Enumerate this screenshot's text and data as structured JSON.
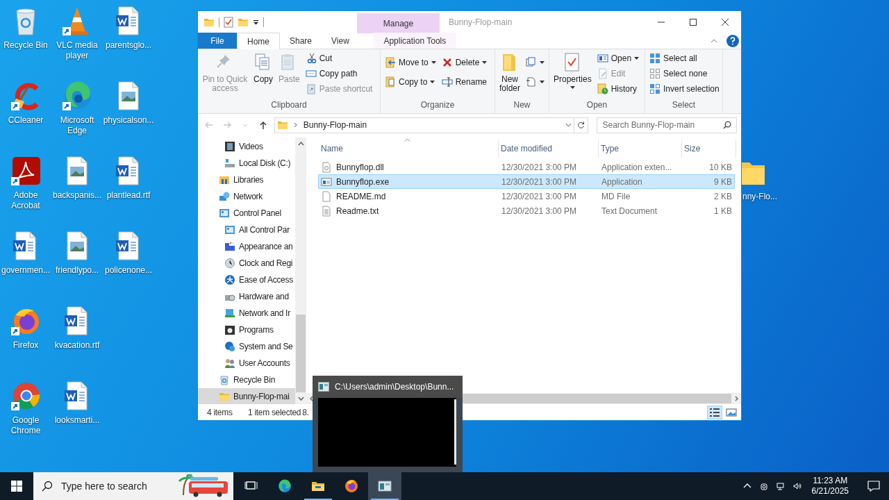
{
  "desktop_rows": [
    [
      {
        "label": "Recycle Bin",
        "kind": "recycle",
        "shortcut": false
      },
      {
        "label": "VLC media player",
        "kind": "vlc",
        "shortcut": true
      },
      {
        "label": "parentsglo...",
        "kind": "word",
        "shortcut": false
      }
    ],
    [
      {
        "label": "CCleaner",
        "kind": "ccleaner",
        "shortcut": true
      },
      {
        "label": "Microsoft Edge",
        "kind": "edge",
        "shortcut": true
      },
      {
        "label": "physicalson...",
        "kind": "image",
        "shortcut": false
      }
    ],
    [
      {
        "label": "Adobe Acrobat",
        "kind": "acrobat",
        "shortcut": true
      },
      {
        "label": "backspanis...",
        "kind": "image",
        "shortcut": false
      },
      {
        "label": "plantlead.rtf",
        "kind": "word",
        "shortcut": false
      }
    ],
    [
      {
        "label": "governmen...",
        "kind": "word",
        "shortcut": false
      },
      {
        "label": "friendlypo...",
        "kind": "image",
        "shortcut": false
      },
      {
        "label": "policenone...",
        "kind": "word",
        "shortcut": false
      }
    ],
    [
      {
        "label": "Firefox",
        "kind": "firefox",
        "shortcut": true
      },
      {
        "label": "kvacation.rtf",
        "kind": "word",
        "shortcut": false
      }
    ],
    [
      {
        "label": "Google Chrome",
        "kind": "chrome",
        "shortcut": true
      },
      {
        "label": "looksmarti...",
        "kind": "word",
        "shortcut": false
      }
    ]
  ],
  "desktop_icon_right": {
    "label": "nny-Flo...",
    "kind": "folder"
  },
  "explorer": {
    "title": "Bunny-Flop-main",
    "context_header": "Manage",
    "tabs": [
      {
        "label": "File",
        "kind": "file",
        "selected": false
      },
      {
        "label": "Home",
        "kind": "normal",
        "selected": true
      },
      {
        "label": "Share",
        "kind": "normal",
        "selected": false
      },
      {
        "label": "View",
        "kind": "normal",
        "selected": false
      },
      {
        "label": "Application Tools",
        "kind": "context",
        "selected": false
      }
    ],
    "ribbon": [
      {
        "label": "Clipboard",
        "items": [
          {
            "label": "Pin to Quick access",
            "kind": "pin",
            "disabled": true,
            "dropdown": false
          },
          {
            "label": "Copy",
            "kind": "copy",
            "disabled": false,
            "dropdown": false
          },
          {
            "label": "Paste",
            "kind": "paste",
            "disabled": true,
            "dropdown": false
          },
          {
            "label": "Cut",
            "kind": "cut",
            "disabled": false,
            "dropdown": false
          },
          {
            "label": "Copy path",
            "kind": "copypath",
            "disabled": false,
            "dropdown": false
          },
          {
            "label": "Paste shortcut",
            "kind": "pasteshortcut",
            "disabled": true,
            "dropdown": false
          }
        ]
      },
      {
        "label": "Organize",
        "items": [
          {
            "label": "Move to",
            "kind": "moveto",
            "disabled": false,
            "dropdown": true
          },
          {
            "label": "Copy to",
            "kind": "copyto",
            "disabled": false,
            "dropdown": true
          },
          {
            "label": "Delete",
            "kind": "delete",
            "disabled": false,
            "dropdown": true
          },
          {
            "label": "Rename",
            "kind": "rename",
            "disabled": false,
            "dropdown": false
          }
        ]
      },
      {
        "label": "New",
        "items": [
          {
            "label": "New folder",
            "kind": "newfolder",
            "disabled": false,
            "dropdown": false
          },
          {
            "kind": "newitem",
            "disabled": false,
            "dropdown": true
          },
          {
            "kind": "easyaccess",
            "disabled": false,
            "dropdown": true
          }
        ]
      },
      {
        "label": "Open",
        "items": [
          {
            "label": "Properties",
            "kind": "properties",
            "disabled": false,
            "dropdown": true
          },
          {
            "label": "Open",
            "kind": "open",
            "disabled": false,
            "dropdown": true
          },
          {
            "label": "Edit",
            "kind": "edit",
            "disabled": true,
            "dropdown": false
          },
          {
            "label": "History",
            "kind": "history",
            "disabled": false,
            "dropdown": false
          }
        ]
      },
      {
        "label": "Select",
        "items": [
          {
            "label": "Select all",
            "kind": "selectall",
            "disabled": false,
            "dropdown": false
          },
          {
            "label": "Select none",
            "kind": "selectnone",
            "disabled": false,
            "dropdown": false
          },
          {
            "label": "Invert selection",
            "kind": "invert",
            "disabled": false,
            "dropdown": false
          }
        ]
      }
    ],
    "address": "Bunny-Flop-main",
    "search_placeholder": "Search Bunny-Flop-main",
    "nav_scrolled_children": [
      {
        "label": "Videos",
        "kind": "videos",
        "selected": false
      },
      {
        "label": "Local Disk (C:)",
        "kind": "disk",
        "selected": false
      }
    ],
    "nav": [
      {
        "label": "Libraries",
        "kind": "libraries",
        "selected": false
      },
      {
        "label": "Network",
        "kind": "network",
        "selected": false
      },
      {
        "label": "Control Panel",
        "kind": "control",
        "selected": false,
        "children": [
          {
            "label": "All Control Par",
            "kind": "control",
            "selected": false
          },
          {
            "label": "Appearance an",
            "kind": "appearance",
            "selected": false
          },
          {
            "label": "Clock and Regi",
            "kind": "clock",
            "selected": false
          },
          {
            "label": "Ease of Access",
            "kind": "ease",
            "selected": false
          },
          {
            "label": "Hardware and",
            "kind": "hardware",
            "selected": false
          },
          {
            "label": "Network and Ir",
            "kind": "netint",
            "selected": false
          },
          {
            "label": "Programs",
            "kind": "programs",
            "selected": false
          },
          {
            "label": "System and Se",
            "kind": "system",
            "selected": false
          },
          {
            "label": "User Accounts",
            "kind": "users",
            "selected": false
          }
        ]
      },
      {
        "label": "Recycle Bin",
        "kind": "recycle",
        "selected": false
      },
      {
        "label": "Bunny-Flop-mai",
        "kind": "folder",
        "selected": true
      }
    ],
    "columns": [
      "Name",
      "Date modified",
      "Type",
      "Size"
    ],
    "rows": [
      {
        "name": "Bunnyflop.dll",
        "date": "12/30/2021 3:00 PM",
        "type": "Application exten...",
        "size": "10 KB",
        "kind": "dll",
        "selected": false
      },
      {
        "name": "Bunnyflop.exe",
        "date": "12/30/2021 3:00 PM",
        "type": "Application",
        "size": "9 KB",
        "kind": "exe",
        "selected": true
      },
      {
        "name": "README.md",
        "date": "12/30/2021 3:00 PM",
        "type": "MD File",
        "size": "2 KB",
        "kind": "blank",
        "selected": false
      },
      {
        "name": "Readme.txt",
        "date": "12/30/2021 3:00 PM",
        "type": "Text Document",
        "size": "1 KB",
        "kind": "text",
        "selected": false
      }
    ],
    "status": [
      "4 items",
      "1 item selected",
      "8."
    ],
    "views": [
      {
        "kind": "details",
        "selected": true
      },
      {
        "kind": "tiles",
        "selected": false
      }
    ]
  },
  "console_thumbnail": {
    "title": "C:\\Users\\admin\\Desktop\\Bunn..."
  },
  "taskbar": {
    "search_placeholder": "Type here to search",
    "apps": [
      {
        "kind": "taskview",
        "active": false
      },
      {
        "kind": "edge",
        "active": false
      },
      {
        "kind": "explorer",
        "active": false,
        "running": true
      },
      {
        "kind": "firefox",
        "active": false,
        "running": false
      },
      {
        "kind": "console",
        "active": true,
        "running": true
      }
    ],
    "time": "11:23 AM",
    "date": "6/21/2025"
  }
}
